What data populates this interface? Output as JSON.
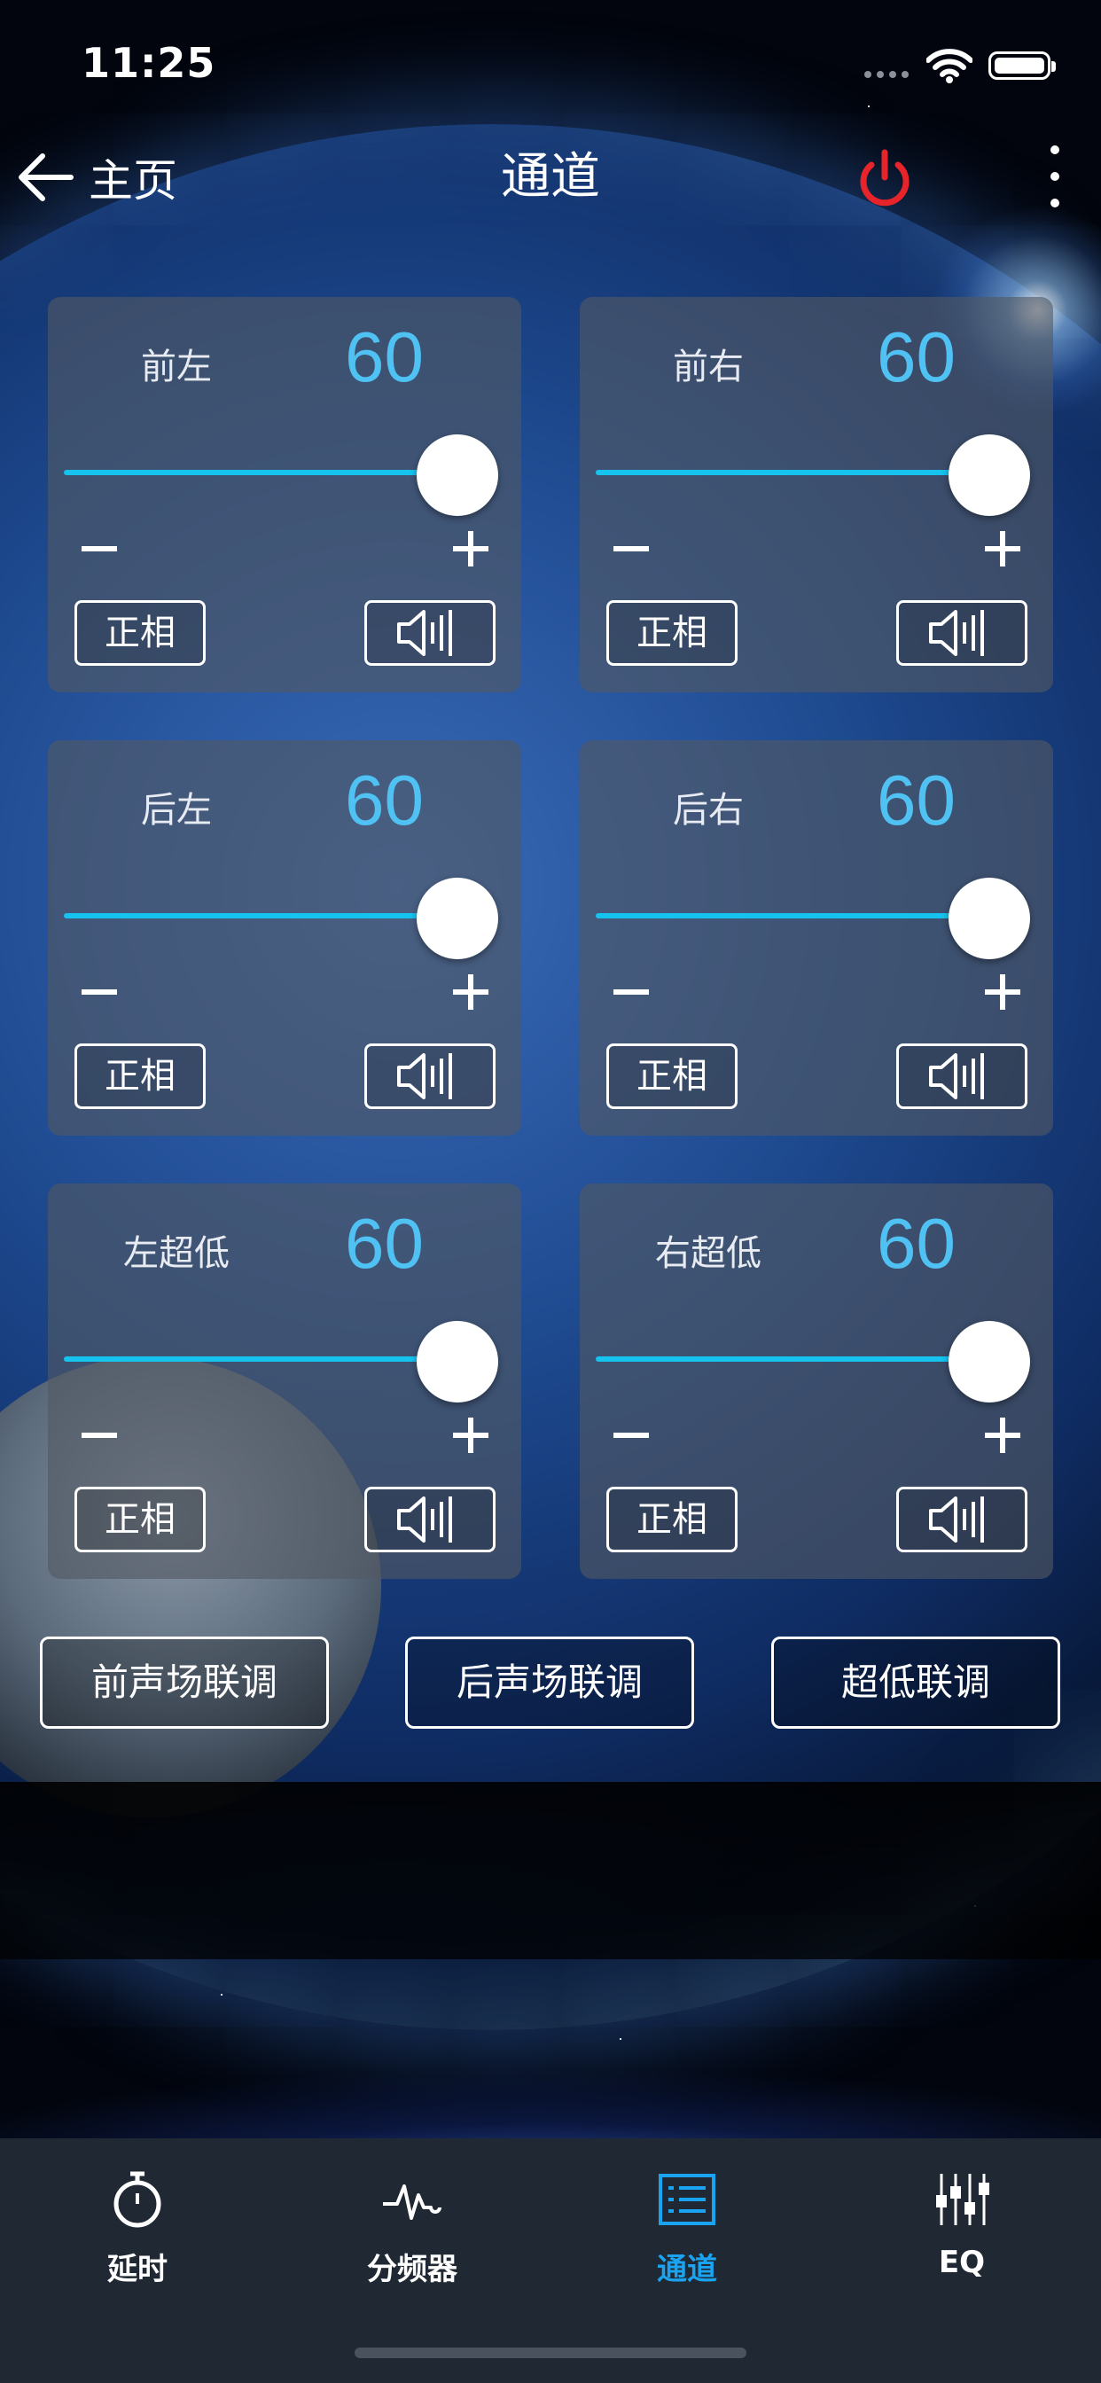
{
  "status_bar": {
    "time": "11:25"
  },
  "nav": {
    "back_label": "主页",
    "title": "通道"
  },
  "channels": [
    {
      "name": "前左",
      "value": "60",
      "level": 1.0,
      "phase_label": "正相"
    },
    {
      "name": "前右",
      "value": "60",
      "level": 1.0,
      "phase_label": "正相"
    },
    {
      "name": "后左",
      "value": "60",
      "level": 1.0,
      "phase_label": "正相"
    },
    {
      "name": "后右",
      "value": "60",
      "level": 1.0,
      "phase_label": "正相"
    },
    {
      "name": "左超低",
      "value": "60",
      "level": 1.0,
      "phase_label": "正相"
    },
    {
      "name": "右超低",
      "value": "60",
      "level": 1.0,
      "phase_label": "正相"
    }
  ],
  "linkage": [
    {
      "label": "前声场联调"
    },
    {
      "label": "后声场联调"
    },
    {
      "label": "超低联调"
    }
  ],
  "tabs": [
    {
      "label": "延时",
      "icon": "stopwatch-icon",
      "active": false
    },
    {
      "label": "分频器",
      "icon": "waveform-icon",
      "active": false
    },
    {
      "label": "通道",
      "icon": "list-icon",
      "active": true
    },
    {
      "label": "EQ",
      "icon": "equalizer-icon",
      "active": false
    }
  ],
  "colors": {
    "accent": "#4fc1f2",
    "slider_track": "#16c2ee",
    "power": "#e8242b",
    "tab_active": "#1aa3f0",
    "tab_inactive": "#ffffff",
    "tabbar_bg": "#1f2833"
  }
}
